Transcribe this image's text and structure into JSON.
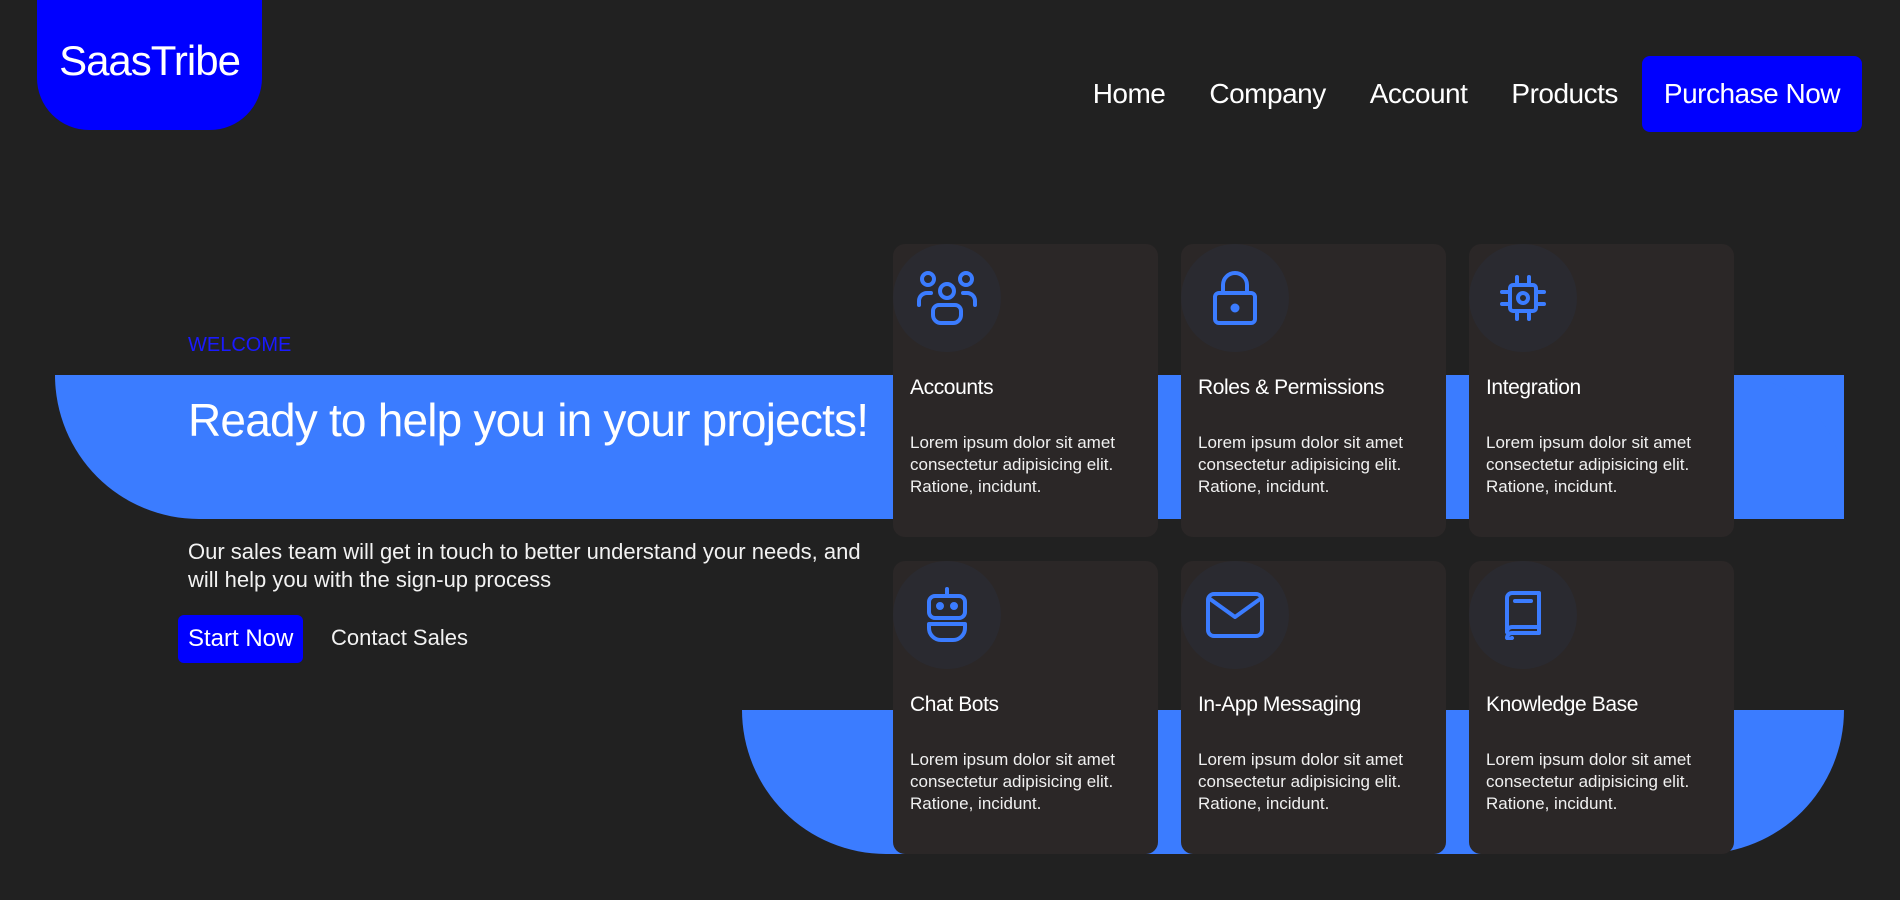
{
  "brand": {
    "logo_text": "SaasTribe"
  },
  "nav": {
    "links": [
      "Home",
      "Company",
      "Account",
      "Products"
    ],
    "cta_label": "Purchase Now"
  },
  "hero": {
    "eyebrow": "WELCOME",
    "headline": "Ready to help you in your projects!",
    "subtext": "Our sales team will get in touch to better understand your needs, and will help you with the sign-up process",
    "primary_button": "Start Now",
    "secondary_link": "Contact Sales"
  },
  "features": [
    {
      "icon": "users-icon",
      "title": "Accounts",
      "text": "Lorem ipsum dolor sit amet consectetur adipisicing elit. Ratione, incidunt."
    },
    {
      "icon": "lock-icon",
      "title": "Roles & Permissions",
      "text": "Lorem ipsum dolor sit amet consectetur adipisicing elit. Ratione, incidunt."
    },
    {
      "icon": "chip-icon",
      "title": "Integration",
      "text": "Lorem ipsum dolor sit amet consectetur adipisicing elit. Ratione, incidunt."
    },
    {
      "icon": "robot-icon",
      "title": "Chat Bots",
      "text": "Lorem ipsum dolor sit amet consectetur adipisicing elit. Ratione, incidunt."
    },
    {
      "icon": "mail-icon",
      "title": "In-App Messaging",
      "text": "Lorem ipsum dolor sit amet consectetur adipisicing elit. Ratione, incidunt."
    },
    {
      "icon": "book-icon",
      "title": "Knowledge Base",
      "text": "Lorem ipsum dolor sit amet consectetur adipisicing elit. Ratione, incidunt."
    }
  ],
  "colors": {
    "background": "#212121",
    "brand_blue": "#0000ff",
    "accent_blue": "#3b7cff",
    "card_background": "#2b2727",
    "icon_color": "#3b7cff"
  }
}
